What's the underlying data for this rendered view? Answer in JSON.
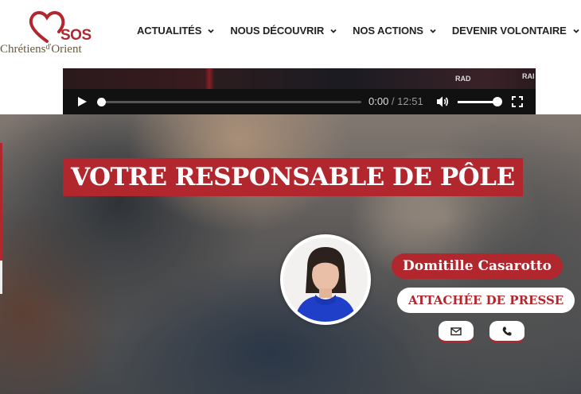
{
  "logo": {
    "sos": "SOS",
    "text_main": "Chrétiens",
    "text_sup": "d'",
    "text_end": "Orient"
  },
  "nav": {
    "items": [
      {
        "label": "ACTUALITÉS"
      },
      {
        "label": "NOUS DÉCOUVRIR"
      },
      {
        "label": "NOS ACTIONS"
      },
      {
        "label": "DEVENIR VOLONTAIRE"
      }
    ]
  },
  "video": {
    "current_time": "0:00",
    "separator": " / ",
    "duration": "12:51",
    "progress": 0,
    "volume": 1,
    "frame_text_1": "RAD",
    "frame_text_2": "RAI"
  },
  "hero": {
    "title": "VOTRE RESPONSABLE DE PÔLE",
    "name": "Domitille Casarotto",
    "role": "ATTACHÉE DE PRESSE",
    "contact_icons": [
      "mail-icon",
      "phone-icon"
    ]
  },
  "colors": {
    "brand_red": "#b2272d",
    "logo_gold": "#6b5a3a",
    "avatar_blue": "#1f3fc9"
  }
}
